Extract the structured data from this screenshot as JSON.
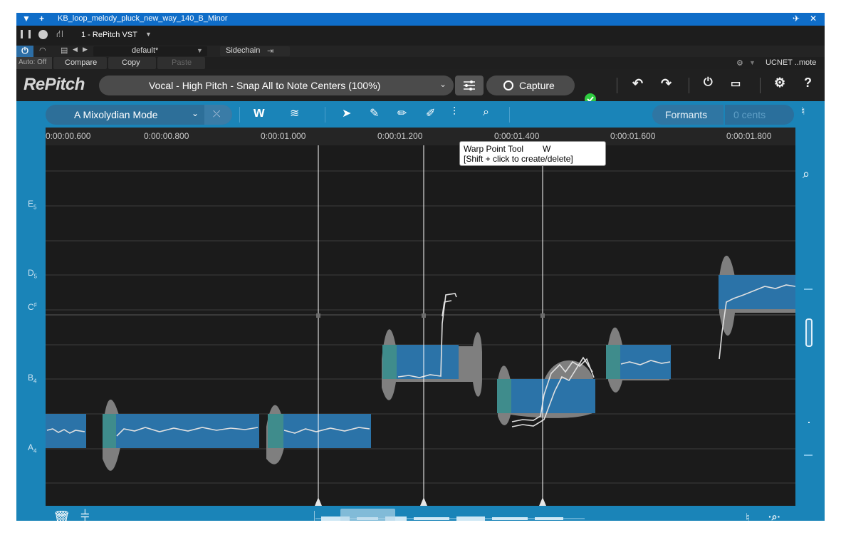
{
  "host": {
    "window_title": "KB_loop_melody_pluck_new_way_140_B_Minor",
    "plugin_slot": "1 - RePitch VST",
    "preset_name": "default*",
    "sidechain_label": "Sidechain",
    "auto_label": "Auto: Off",
    "compare_label": "Compare",
    "copy_label": "Copy",
    "paste_label": "Paste",
    "remote_label": "UCNET ..mote"
  },
  "repitch": {
    "logo": "RePitch",
    "preset": "Vocal - High Pitch - Snap All to Note Centers (100%)",
    "capture_label": "Capture",
    "status_color": "#2ecc40"
  },
  "toolbar": {
    "scale_mode": "A Mixolydian Mode",
    "formants_label": "Formants",
    "cents_value": "0 cents"
  },
  "timeline": {
    "ticks": [
      "0:00:00.600",
      "0:00:00.800",
      "0:00:01.000",
      "0:00:01.200",
      "0:00:01.400",
      "0:00:01.600",
      "0:00:01.800"
    ]
  },
  "notes": [
    {
      "name": "E",
      "octave": "5"
    },
    {
      "name": "D",
      "octave": "5"
    },
    {
      "name": "C",
      "sharp": "♯"
    },
    {
      "name": "B",
      "octave": "4"
    },
    {
      "name": "A",
      "octave": "4"
    }
  ],
  "tooltip": {
    "title": "Warp Point Tool",
    "shortcut": "W",
    "hint": "[Shift + click to create/delete]"
  },
  "colors": {
    "blob_fill": "#2b73a8",
    "blob_onset": "#3f8c8c",
    "wave": "#8a8a8a",
    "accent_blue": "#1a84b8"
  }
}
